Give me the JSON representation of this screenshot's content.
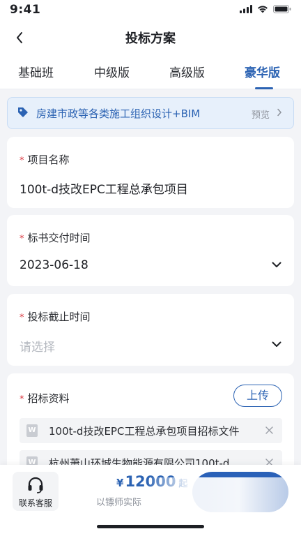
{
  "status": {
    "time": "9:41"
  },
  "nav": {
    "title": "投标方案"
  },
  "tabs": [
    {
      "label": "基础班",
      "active": false
    },
    {
      "label": "中级版",
      "active": false
    },
    {
      "label": "高级版",
      "active": false
    },
    {
      "label": "豪华版",
      "active": true
    }
  ],
  "banner": {
    "text": "房建市政等各类施工组织设计+BIM",
    "preview_label": "预览"
  },
  "fields": {
    "project_name": {
      "label": "项目名称",
      "required_mark": "*",
      "value": "100t-d技改EPC工程总承包项目"
    },
    "delivery_time": {
      "label": "标书交付时间",
      "required_mark": "*",
      "value": "2023-06-18"
    },
    "deadline": {
      "label": "投标截止时间",
      "required_mark": "*",
      "placeholder": "请选择"
    },
    "tender_docs": {
      "label": "招标资料",
      "required_mark": "*",
      "upload_label": "上传",
      "files": [
        {
          "icon": "W",
          "name": "100t-d技改EPC工程总承包项目招标文件"
        },
        {
          "icon": "W",
          "name": "杭州萧山环城生物能源有限公司100t-d..."
        }
      ]
    }
  },
  "bottom": {
    "service_label": "联系客服",
    "price_symbol": "¥",
    "price_value": "12000",
    "price_unit": "起",
    "price_note": "以镖师实际"
  },
  "colors": {
    "accent": "#2c63b3",
    "required": "#d9363e",
    "page_bg": "#f3f4f7"
  },
  "icons": [
    "back-arrow-icon",
    "tag-icon",
    "chevron-right-icon",
    "chevron-down-icon",
    "word-file-icon",
    "close-icon",
    "headset-icon",
    "signal-icon",
    "wifi-icon",
    "battery-icon"
  ]
}
